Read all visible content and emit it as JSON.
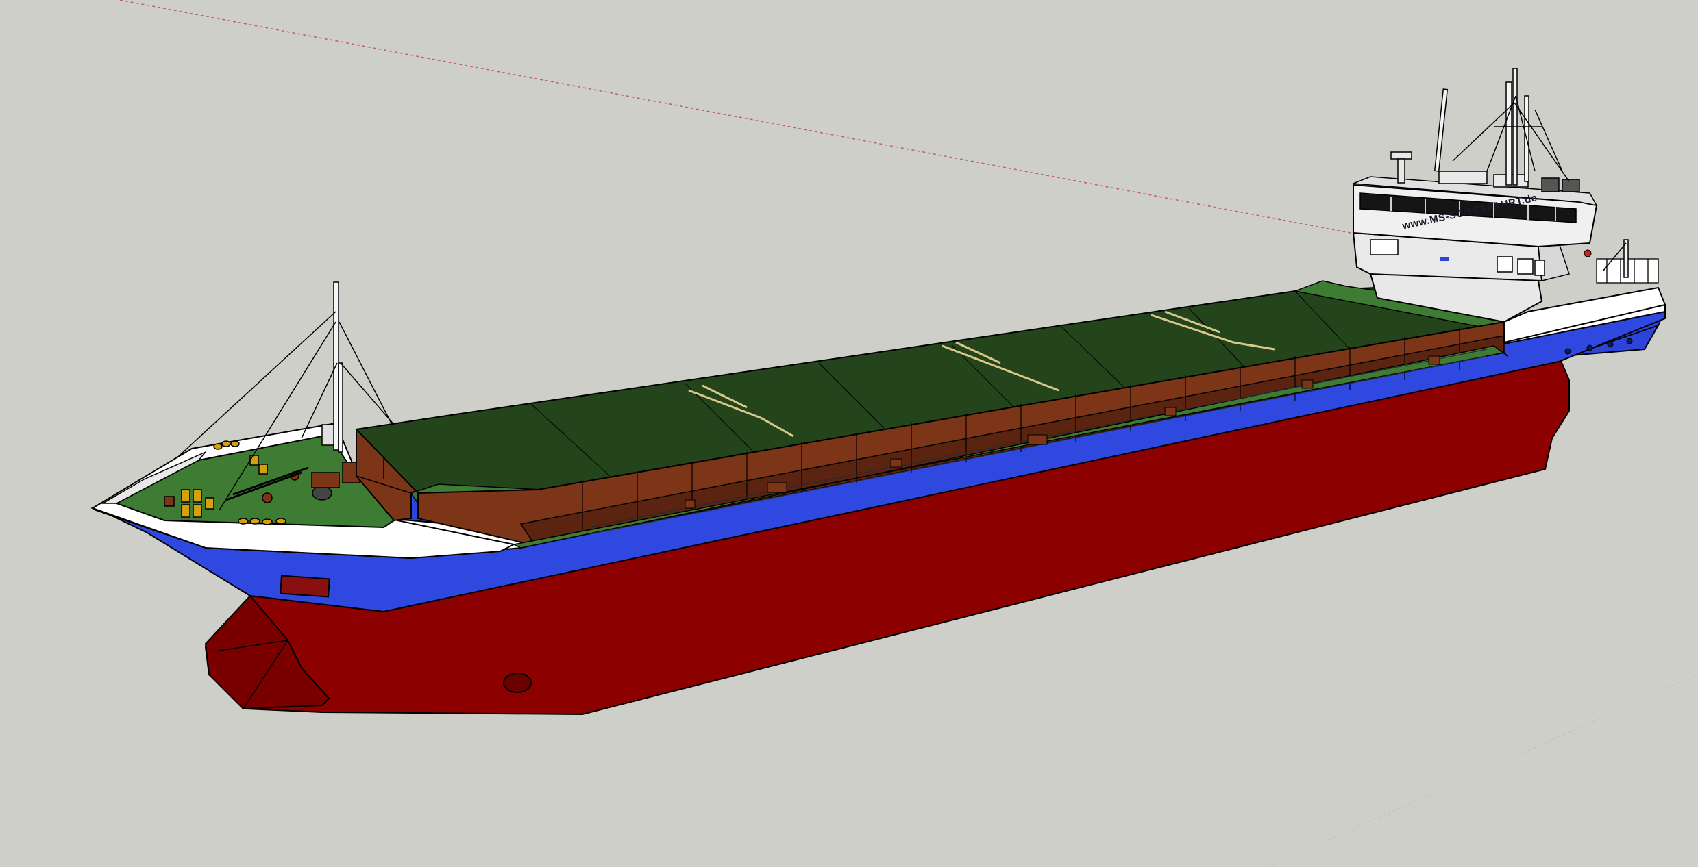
{
  "scene": {
    "model": "coastal-cargo-ship",
    "background_color": "#cfcfca",
    "bridge_text": "www.MS-SCHIFFFAHRT.de",
    "colors": {
      "hull_bottom": "#8c0000",
      "hull_band": "#2c44d8",
      "hull_upper": "#ffffff",
      "hatch_cover": "#24451c",
      "hatch_coaming": "#7d3518",
      "deck_green": "#3e7c34",
      "superstructure": "#e9e9e9",
      "window": "#151515",
      "axis_red": "#c06060"
    }
  }
}
